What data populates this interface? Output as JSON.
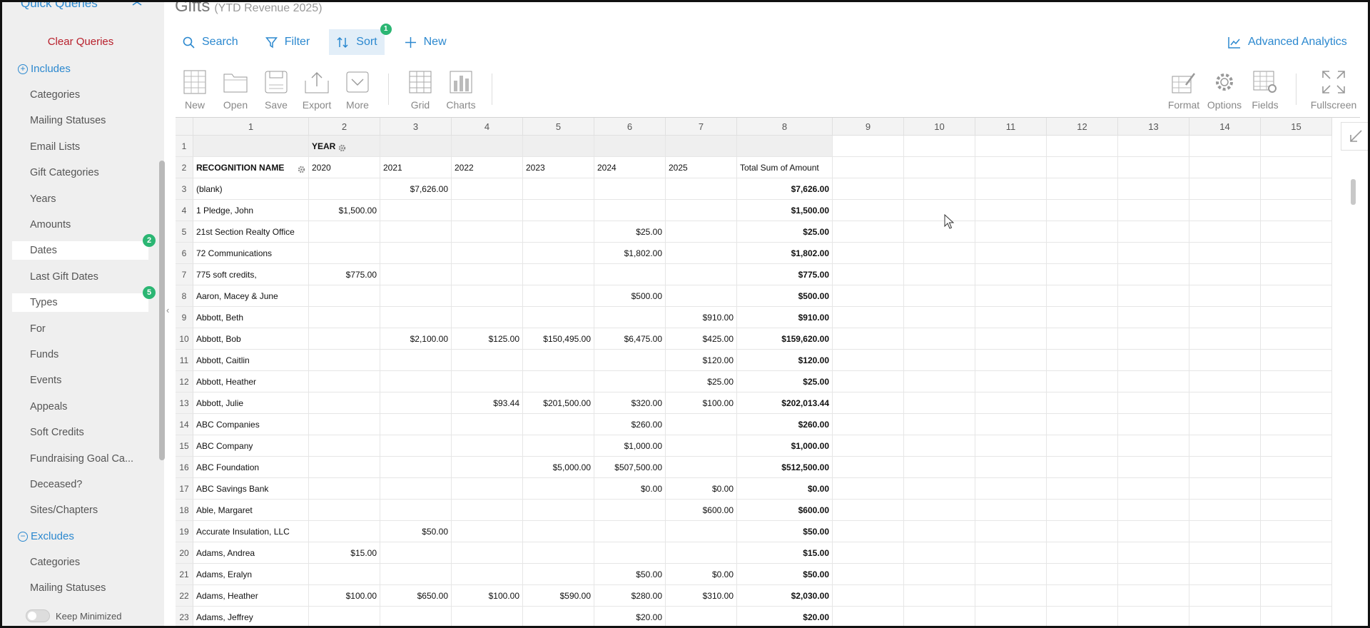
{
  "sidebar": {
    "quick_queries_title": "Quick Queries",
    "clear_queries": "Clear Queries",
    "includes_label": "Includes",
    "excludes_label": "Excludes",
    "includes": [
      {
        "label": "Categories",
        "badge": ""
      },
      {
        "label": "Mailing Statuses",
        "badge": ""
      },
      {
        "label": "Email Lists",
        "badge": ""
      },
      {
        "label": "Gift Categories",
        "badge": ""
      },
      {
        "label": "Years",
        "badge": ""
      },
      {
        "label": "Amounts",
        "badge": ""
      },
      {
        "label": "Dates",
        "badge": "2"
      },
      {
        "label": "Last Gift Dates",
        "badge": ""
      },
      {
        "label": "Types",
        "badge": "5"
      },
      {
        "label": "For",
        "badge": ""
      },
      {
        "label": "Funds",
        "badge": ""
      },
      {
        "label": "Events",
        "badge": ""
      },
      {
        "label": "Appeals",
        "badge": ""
      },
      {
        "label": "Soft Credits",
        "badge": ""
      },
      {
        "label": "Fundraising Goal Ca...",
        "badge": ""
      },
      {
        "label": "Deceased?",
        "badge": ""
      },
      {
        "label": "Sites/Chapters",
        "badge": ""
      }
    ],
    "excludes": [
      {
        "label": "Categories"
      },
      {
        "label": "Mailing Statuses"
      }
    ],
    "keep_minimized": "Keep Minimized"
  },
  "header": {
    "title": "Gifts",
    "subtitle": "(YTD Revenue 2025)"
  },
  "toolbar": {
    "search": "Search",
    "filter": "Filter",
    "sort": "Sort",
    "sort_badge": "1",
    "new": "New",
    "advanced_analytics": "Advanced Analytics"
  },
  "ribbon": {
    "new": "New",
    "open": "Open",
    "save": "Save",
    "export": "Export",
    "more": "More",
    "grid": "Grid",
    "charts": "Charts",
    "format": "Format",
    "options": "Options",
    "fields": "Fields",
    "fullscreen": "Fullscreen"
  },
  "grid": {
    "column_numbers": [
      "1",
      "2",
      "3",
      "4",
      "5",
      "6",
      "7",
      "8",
      "9",
      "10",
      "11",
      "12",
      "13",
      "14",
      "15"
    ],
    "column_field": "YEAR",
    "row_field": "RECOGNITION NAME",
    "years": [
      "2020",
      "2021",
      "2022",
      "2023",
      "2024",
      "2025"
    ],
    "total_header": "Total Sum of Amount",
    "rows": [
      {
        "name": "(blank)",
        "values": [
          "",
          "$7,626.00",
          "",
          "",
          "",
          ""
        ],
        "total": "$7,626.00"
      },
      {
        "name": "1 Pledge, John",
        "values": [
          "$1,500.00",
          "",
          "",
          "",
          "",
          ""
        ],
        "total": "$1,500.00"
      },
      {
        "name": "21st Section Realty Office",
        "values": [
          "",
          "",
          "",
          "",
          "$25.00",
          ""
        ],
        "total": "$25.00"
      },
      {
        "name": "72 Communications",
        "values": [
          "",
          "",
          "",
          "",
          "$1,802.00",
          ""
        ],
        "total": "$1,802.00"
      },
      {
        "name": "775 soft credits,",
        "values": [
          "$775.00",
          "",
          "",
          "",
          "",
          ""
        ],
        "total": "$775.00"
      },
      {
        "name": "Aaron, Macey & June",
        "values": [
          "",
          "",
          "",
          "",
          "$500.00",
          ""
        ],
        "total": "$500.00"
      },
      {
        "name": "Abbott, Beth",
        "values": [
          "",
          "",
          "",
          "",
          "",
          "$910.00"
        ],
        "total": "$910.00"
      },
      {
        "name": "Abbott, Bob",
        "values": [
          "",
          "$2,100.00",
          "$125.00",
          "$150,495.00",
          "$6,475.00",
          "$425.00"
        ],
        "total": "$159,620.00"
      },
      {
        "name": "Abbott, Caitlin",
        "values": [
          "",
          "",
          "",
          "",
          "",
          "$120.00"
        ],
        "total": "$120.00"
      },
      {
        "name": "Abbott, Heather",
        "values": [
          "",
          "",
          "",
          "",
          "",
          "$25.00"
        ],
        "total": "$25.00"
      },
      {
        "name": "Abbott, Julie",
        "values": [
          "",
          "",
          "$93.44",
          "$201,500.00",
          "$320.00",
          "$100.00"
        ],
        "total": "$202,013.44"
      },
      {
        "name": "ABC Companies",
        "values": [
          "",
          "",
          "",
          "",
          "$260.00",
          ""
        ],
        "total": "$260.00"
      },
      {
        "name": "ABC Company",
        "values": [
          "",
          "",
          "",
          "",
          "$1,000.00",
          ""
        ],
        "total": "$1,000.00"
      },
      {
        "name": "ABC Foundation",
        "values": [
          "",
          "",
          "",
          "$5,000.00",
          "$507,500.00",
          ""
        ],
        "total": "$512,500.00"
      },
      {
        "name": "ABC Savings Bank",
        "values": [
          "",
          "",
          "",
          "",
          "$0.00",
          "$0.00"
        ],
        "total": "$0.00"
      },
      {
        "name": "Able, Margaret",
        "values": [
          "",
          "",
          "",
          "",
          "",
          "$600.00"
        ],
        "total": "$600.00"
      },
      {
        "name": "Accurate Insulation, LLC",
        "values": [
          "",
          "$50.00",
          "",
          "",
          "",
          ""
        ],
        "total": "$50.00"
      },
      {
        "name": "Adams, Andrea",
        "values": [
          "$15.00",
          "",
          "",
          "",
          "",
          ""
        ],
        "total": "$15.00"
      },
      {
        "name": "Adams, Eralyn",
        "values": [
          "",
          "",
          "",
          "",
          "$50.00",
          "$0.00"
        ],
        "total": "$50.00"
      },
      {
        "name": "Adams, Heather",
        "values": [
          "$100.00",
          "$650.00",
          "$100.00",
          "$590.00",
          "$280.00",
          "$310.00"
        ],
        "total": "$2,030.00"
      },
      {
        "name": "Adams, Jeffrey",
        "values": [
          "",
          "",
          "",
          "",
          "$20.00",
          ""
        ],
        "total": "$20.00"
      }
    ]
  },
  "colors": {
    "accent": "#2b88cf",
    "badge": "#2bb673",
    "danger": "#b8202c"
  }
}
